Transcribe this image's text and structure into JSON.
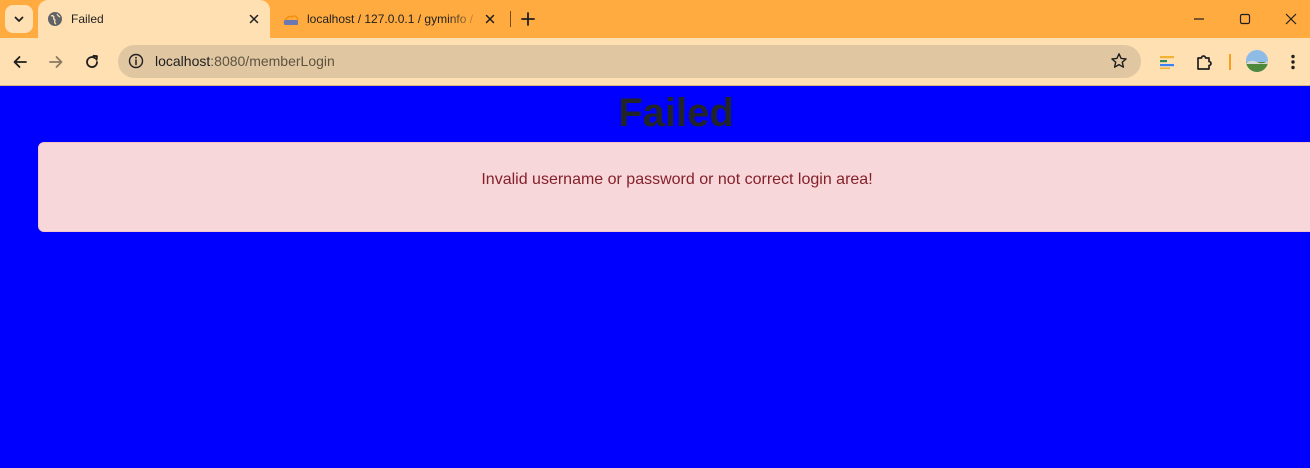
{
  "browser": {
    "tabs": [
      {
        "title": "Failed",
        "active": true,
        "icon": "globe-icon"
      },
      {
        "title": "localhost / 127.0.0.1 / gyminfo / ",
        "active": false,
        "icon": "phpmyadmin-icon"
      }
    ],
    "address_bar": {
      "host": "localhost",
      "path": ":8080/memberLogin"
    },
    "colors": {
      "tab_strip": "#ffab40",
      "toolbar": "#ffe0b2",
      "omnibox": "#e0c7a2"
    }
  },
  "page": {
    "heading": "Failed",
    "alert": {
      "message": "Invalid username or password or not correct login area!",
      "type": "danger"
    },
    "colors": {
      "background": "#0000ff",
      "alert_bg": "#f8d7da",
      "alert_text": "#842029",
      "heading": "#212529"
    }
  }
}
